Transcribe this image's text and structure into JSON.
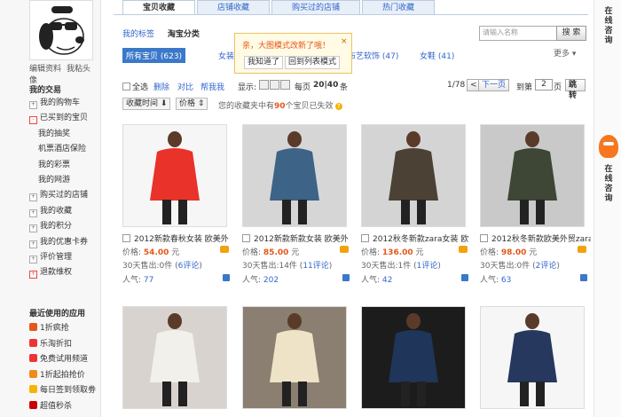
{
  "sidebar": {
    "profile_links": [
      "编辑资料",
      "我粘头像"
    ],
    "my_trade_title": "我的交易",
    "trade_items": [
      {
        "label": "我的购物车",
        "sub": false,
        "box": "+"
      },
      {
        "label": "已买到的宝贝",
        "sub": false,
        "box": "-",
        "red": true
      },
      {
        "label": "我的抽奖",
        "sub": true
      },
      {
        "label": "机票酒店保险",
        "sub": true
      },
      {
        "label": "我的彩票",
        "sub": true
      },
      {
        "label": "我的网游",
        "sub": true
      },
      {
        "label": "购买过的店铺",
        "sub": false,
        "box": "+"
      },
      {
        "label": "我的收藏",
        "sub": false,
        "box": "+"
      },
      {
        "label": "我的积分",
        "sub": false,
        "box": "+"
      },
      {
        "label": "我的优惠卡券",
        "sub": false,
        "box": "+"
      },
      {
        "label": "评价管理",
        "sub": false,
        "box": "+"
      },
      {
        "label": "退款维权",
        "sub": false,
        "box": "+",
        "red": true
      }
    ],
    "recent_apps_title": "最近使用的应用",
    "apps": [
      {
        "label": "1折疯抢",
        "color": "#e4571a"
      },
      {
        "label": "乐淘折扣",
        "color": "#e33"
      },
      {
        "label": "免费试用频道",
        "color": "#e33"
      },
      {
        "label": "1折起拍抢价",
        "color": "#f08a1b"
      },
      {
        "label": "每日签到领取劵",
        "color": "#f5b400"
      },
      {
        "label": "超值秒杀",
        "color": "#c00"
      }
    ]
  },
  "tabs": [
    "宝贝收藏",
    "店铺收藏",
    "购买过的店铺",
    "热门收藏"
  ],
  "catbar": {
    "row1": [
      "我的标签",
      "淘宝分类"
    ],
    "all_label": "所有宝贝 (623)",
    "cat_links": [
      "女装",
      "布艺软饰 (47)",
      "女鞋 (41)"
    ],
    "more": "更多 ▾"
  },
  "search": {
    "placeholder": "请输入名称",
    "button": "搜 索"
  },
  "popup": {
    "message": "亲，大图模式改新了哦！",
    "close": "×",
    "btn_ok": "我知道了",
    "btn_back": "回到列表模式"
  },
  "toolbar": {
    "select_all": "全选",
    "delete": "删除",
    "compare": "对比",
    "help_me": "帮我我",
    "display": "显示:",
    "per_page_prefix": "每页",
    "per_page_opts": "20|40",
    "per_page_suffix": "条",
    "page_info": "1/78",
    "prev": "<",
    "next": "下一页",
    "goto_prefix": "到第",
    "page_value": "2",
    "goto_suffix": "页",
    "jump": "跳转"
  },
  "sortbar": {
    "sort_time": "收藏时间",
    "sort_price": "价格",
    "hint_prefix": "您的收藏夹中有",
    "hint_num": "90",
    "hint_suffix": "个宝贝已失效"
  },
  "products": [
    {
      "title": "2012新款春秋女装 欧美外",
      "price_label": "价格:",
      "price": "54.00",
      "unit": "元",
      "sales": "30天售出:0件 (",
      "reviews": "6评论",
      "sales_end": ")",
      "pop_label": "人气:",
      "pop": "77",
      "img_color": "#e8322a",
      "bg": "#f6f6f6"
    },
    {
      "title": "2012新款新款女装 欧美外",
      "price_label": "价格:",
      "price": "85.00",
      "unit": "元",
      "sales": "30天售出:14件 (",
      "reviews": "11评论",
      "sales_end": ")",
      "pop_label": "人气:",
      "pop": "202",
      "img_color": "#3d6387",
      "bg": "#d6d6d6"
    },
    {
      "title": "2012秋冬新款zara女装 欧",
      "price_label": "价格:",
      "price": "136.00",
      "unit": "元",
      "sales": "30天售出:1件 (",
      "reviews": "1评论",
      "sales_end": ")",
      "pop_label": "人气:",
      "pop": "42",
      "img_color": "#4b4134",
      "bg": "#d4d4d4"
    },
    {
      "title": "2012秋冬新款欧美外贸zara新款",
      "price_label": "价格:",
      "price": "98.00",
      "unit": "元",
      "sales": "30天售出:0件 (",
      "reviews": "2评论",
      "sales_end": ")",
      "pop_label": "人气:",
      "pop": "63",
      "img_color": "#3e4636",
      "bg": "#c9c9c9"
    },
    {
      "title": "",
      "price_label": "",
      "price": "",
      "unit": "",
      "sales": "",
      "reviews": "",
      "sales_end": "",
      "pop_label": "",
      "pop": "",
      "img_color": "#f2f0ea",
      "bg": "#d9d3cf"
    },
    {
      "title": "",
      "price_label": "",
      "price": "",
      "unit": "",
      "sales": "",
      "reviews": "",
      "sales_end": "",
      "pop_label": "",
      "pop": "",
      "img_color": "#efe3c7",
      "bg": "#8a7f70"
    },
    {
      "title": "",
      "price_label": "",
      "price": "",
      "unit": "",
      "sales": "",
      "reviews": "",
      "sales_end": "",
      "pop_label": "",
      "pop": "",
      "img_color": "#1f3559",
      "bg": "#1c1c1c"
    },
    {
      "title": "",
      "price_label": "",
      "price": "",
      "unit": "",
      "sales": "",
      "reviews": "",
      "sales_end": "",
      "pop_label": "",
      "pop": "",
      "img_color": "#26385e",
      "bg": "#f6f6f6"
    }
  ],
  "right": {
    "online1": "在线咨询",
    "online2": "在线咨询"
  }
}
